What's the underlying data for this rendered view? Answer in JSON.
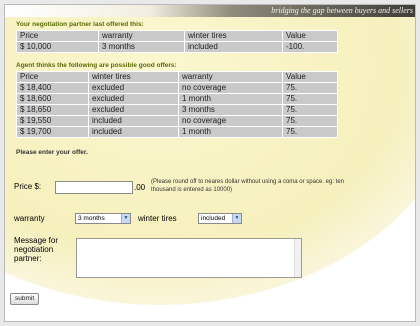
{
  "banner": {
    "tagline": "bridging the gap between buyers and sellers"
  },
  "last_offer": {
    "heading": "Your negotiation partner last offered this:",
    "columns": [
      "Price",
      "warranty",
      "winter tires",
      "Value"
    ],
    "row": [
      "$ 10,000",
      "3 months",
      "included",
      "-100."
    ]
  },
  "good_offers": {
    "heading": "Agent thinks the following are possible good offers:",
    "columns": [
      "Price",
      "winter tires",
      "warranty",
      "Value"
    ],
    "rows": [
      [
        "$ 18,400",
        "excluded",
        "no coverage",
        "75."
      ],
      [
        "$ 18,600",
        "excluded",
        "1 month",
        "75."
      ],
      [
        "$ 18,650",
        "excluded",
        "3 months",
        "75."
      ],
      [
        "$ 19,550",
        "included",
        "no coverage",
        "75."
      ],
      [
        "$ 19,700",
        "included",
        "1 month",
        "75."
      ]
    ]
  },
  "form": {
    "heading": "Please enter your offer.",
    "price_label": "Price $:",
    "price_value": "",
    "cents": ".00",
    "price_note": "(Please round off to neares dollar without using a coma or space. eg: ten thousand is entered as 10000)",
    "warranty_label": "warranty",
    "warranty_selected": "3 months",
    "winter_label": "winter tires",
    "winter_selected": "included",
    "message_label": "Message for negotiation partner:",
    "message_value": "",
    "submit_label": "submit"
  },
  "colors": {
    "table_bg": "#c9c9c9",
    "heading": "#5a6a00",
    "glow": "#f6f0bd"
  }
}
